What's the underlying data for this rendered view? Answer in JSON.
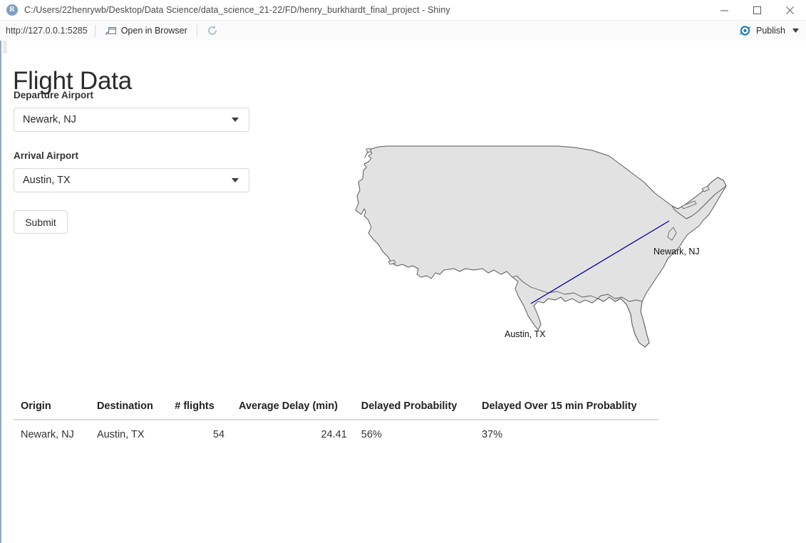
{
  "window": {
    "app_icon": "r-logo-icon",
    "title": "C:/Users/22henrywb/Desktop/Data Science/data_science_21-22/FD/henry_burkhardt_final_project - Shiny",
    "minimize": "minimize-icon",
    "maximize": "maximize-icon",
    "close": "close-icon"
  },
  "toolbar": {
    "url": "http://127.0.0.1:5285",
    "open_in_browser_label": "Open in Browser",
    "open_in_browser_icon": "external-window-icon",
    "refresh_icon": "refresh-icon",
    "publish_label": "Publish",
    "publish_icon": "publish-icon",
    "publish_caret": "chevron-down-icon",
    "accent_color": "#1a7bb9"
  },
  "app": {
    "page_title": "Flight Data",
    "departure": {
      "label": "Departure Airport",
      "value": "Newark, NJ",
      "placeholder": "Newark, NJ"
    },
    "arrival": {
      "label": "Arrival Airport",
      "value": "Austin, TX",
      "placeholder": "Austin, TX"
    },
    "submit_label": "Submit"
  },
  "map": {
    "origin_label": "Newark, NJ",
    "destination_label": "Austin, TX",
    "route_color": "#0000a0",
    "land_fill": "#e2e2e2",
    "land_stroke": "#5a5a5a"
  },
  "table": {
    "headers": [
      "Origin",
      "Destination",
      "# flights",
      "Average Delay (min)",
      "Delayed Probability",
      "Delayed Over 15 min Probablity"
    ],
    "rows": [
      {
        "origin": "Newark, NJ",
        "destination": "Austin, TX",
        "flights": "54",
        "avg_delay": "24.41",
        "delayed_prob": "56%",
        "delayed_15_prob": "37%"
      }
    ]
  }
}
